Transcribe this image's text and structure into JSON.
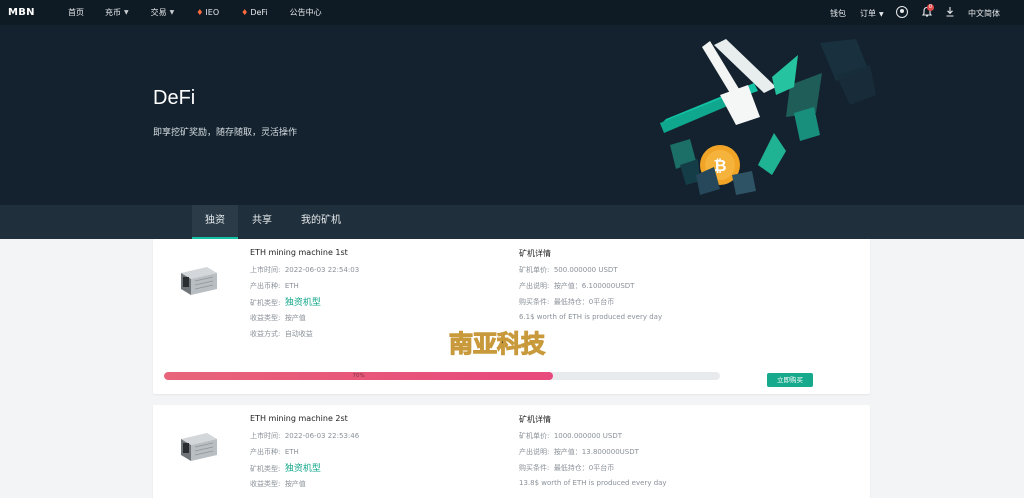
{
  "nav": {
    "logo_small": "",
    "logo": "MBN",
    "home": "首页",
    "recharge": "充币",
    "trade": "交易",
    "ieo": "IEO",
    "defi": "DeFi",
    "announcements": "公告中心",
    "wallet": "钱包",
    "orders": "订单",
    "notification_count": "0",
    "language": "中文简体"
  },
  "hero": {
    "title": "DeFi",
    "subtitle": "即享挖矿奖励，随存随取，灵活操作"
  },
  "tabs": [
    {
      "label": "独资"
    },
    {
      "label": "共享"
    },
    {
      "label": "我的矿机"
    }
  ],
  "cards": [
    {
      "name": "ETH mining machine 1st",
      "launch_label": "上市时间:",
      "launch_value": "2022-06-03 22:54:03",
      "coin_label": "产出币种:",
      "coin_value": "ETH",
      "type_label": "矿机类型:",
      "type_value": "独资机型",
      "yield_type_label": "收益类型:",
      "yield_type_value": "按产值",
      "yield_method_label": "收益方式:",
      "yield_method_value": "自动收益",
      "detail_title": "矿机详情",
      "price_label": "矿机单价:",
      "price_value": "500.000000 USDT",
      "output_label": "产出说明:",
      "output_value": "按产值：6.100000USDT",
      "purchase_label": "购买条件:",
      "purchase_value": "最低持仓：0平台币",
      "description": "6.1$ worth of ETH is produced every day",
      "progress_percent": 70,
      "progress_label": "70%",
      "buy_label": "立即购买"
    },
    {
      "name": "ETH mining machine 2st",
      "launch_label": "上市时间:",
      "launch_value": "2022-06-03 22:53:46",
      "coin_label": "产出币种:",
      "coin_value": "ETH",
      "type_label": "矿机类型:",
      "type_value": "独资机型",
      "yield_type_label": "收益类型:",
      "yield_type_value": "按产值",
      "detail_title": "矿机详情",
      "price_label": "矿机单价:",
      "price_value": "1000.000000 USDT",
      "output_label": "产出说明:",
      "output_value": "按产值：13.800000USDT",
      "purchase_label": "购买条件:",
      "purchase_value": "最低持仓：0平台币",
      "description": "13.8$ worth of ETH is produced every day"
    }
  ],
  "watermark": "南亚科技",
  "colors": {
    "accent": "#13c1a4",
    "nav_bg": "#0f1b24",
    "hero_bg": "#13222e",
    "progress": "#e7497b",
    "buy_button": "#17a98b"
  }
}
